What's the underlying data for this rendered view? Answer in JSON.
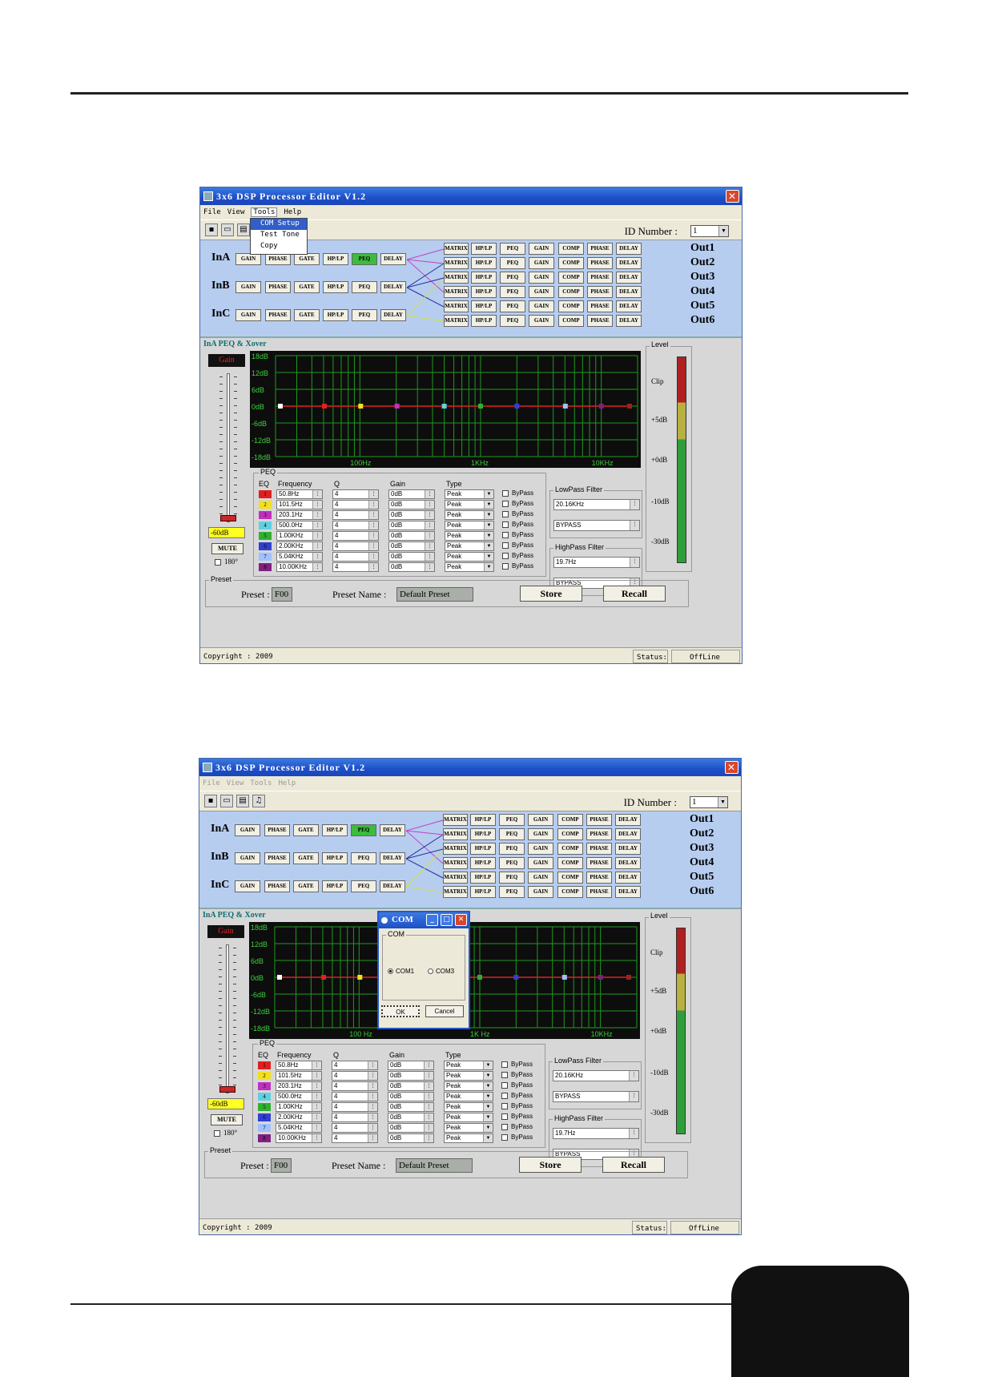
{
  "app_title": "3x6 DSP Processor Editor V1.2",
  "menu": [
    "File",
    "View",
    "Tools",
    "Help"
  ],
  "tools_menu": [
    "COM Setup",
    "Test Tone",
    "Copy"
  ],
  "id_number": {
    "label": "ID Number :",
    "value": "1"
  },
  "inputs": [
    "InA",
    "InB",
    "InC"
  ],
  "input_buttons": [
    "GAIN",
    "PHASE",
    "GATE",
    "HP/LP",
    "PEQ",
    "DELAY"
  ],
  "output_buttons": [
    "MATRIX",
    "HP/LP",
    "PEQ",
    "GAIN",
    "COMP",
    "PHASE",
    "DELAY"
  ],
  "outputs": [
    "Out1",
    "Out2",
    "Out3",
    "Out4",
    "Out5",
    "Out6"
  ],
  "section_title": "InA PEQ & Xover",
  "gain": {
    "title": "Gain",
    "value": "-60dB",
    "mute": "MUTE",
    "phase": "180°"
  },
  "graph": {
    "y_labels": [
      "18dB",
      "12dB",
      "6dB",
      "0dB",
      "-6dB",
      "-12dB",
      "-18dB"
    ],
    "x_labels_1": [
      "100Hz",
      "1KHz",
      "10KHz"
    ],
    "x_labels_2": [
      "100 Hz",
      "1K Hz",
      "10KHz"
    ],
    "point_colors": [
      "#ffffff",
      "#e02020",
      "#f0e020",
      "#c030c0",
      "#60d0e0",
      "#30b030",
      "#3040d0",
      "#a0c0ff",
      "#802080",
      "#a02020"
    ]
  },
  "level": {
    "title": "Level",
    "labels": [
      "Clip",
      "+5dB",
      "+0dB",
      "-10dB",
      "-30dB"
    ]
  },
  "peq": {
    "title": "PEQ",
    "headers": [
      "EQ",
      "Frequency",
      "Q",
      "Gain",
      "Type"
    ],
    "bypass_label": "ByPass",
    "rows": [
      {
        "n": "1",
        "color": "#e02020",
        "freq": "50.8Hz",
        "q": "4",
        "gain": "0dB",
        "type": "Peak"
      },
      {
        "n": "2",
        "color": "#f0e020",
        "freq": "101.5Hz",
        "q": "4",
        "gain": "0dB",
        "type": "Peak"
      },
      {
        "n": "3",
        "color": "#c030c0",
        "freq": "203.1Hz",
        "q": "4",
        "gain": "0dB",
        "type": "Peak"
      },
      {
        "n": "4",
        "color": "#60d0e0",
        "freq": "500.0Hz",
        "q": "4",
        "gain": "0dB",
        "type": "Peak"
      },
      {
        "n": "5",
        "color": "#30b030",
        "freq": "1.00KHz",
        "q": "4",
        "gain": "0dB",
        "type": "Peak"
      },
      {
        "n": "6",
        "color": "#3040d0",
        "freq": "2.00KHz",
        "q": "4",
        "gain": "0dB",
        "type": "Peak"
      },
      {
        "n": "7",
        "color": "#a0c0ff",
        "freq": "5.04KHz",
        "q": "4",
        "gain": "0dB",
        "type": "Peak"
      },
      {
        "n": "8",
        "color": "#802080",
        "freq": "10.00KHz",
        "q": "4",
        "gain": "0dB",
        "type": "Peak"
      }
    ]
  },
  "lowpass": {
    "title": "LowPass Filter",
    "freq": "20.16KHz",
    "mode": "BYPASS"
  },
  "highpass": {
    "title": "HighPass Filter",
    "freq": "19.7Hz",
    "mode": "BYPASS"
  },
  "preset": {
    "title": "Preset",
    "label": "Preset :",
    "value": "F00",
    "name_label": "Preset Name :",
    "name_value": "Default Preset",
    "store": "Store",
    "recall": "Recall"
  },
  "status": {
    "copyright": "Copyright : 2009",
    "status_label": "Status:",
    "status_value": "OffLine"
  },
  "com_dialog": {
    "title": "COM",
    "group": "COM",
    "options": [
      "COM1",
      "COM3"
    ],
    "ok": "OK",
    "cancel": "Cancel"
  }
}
